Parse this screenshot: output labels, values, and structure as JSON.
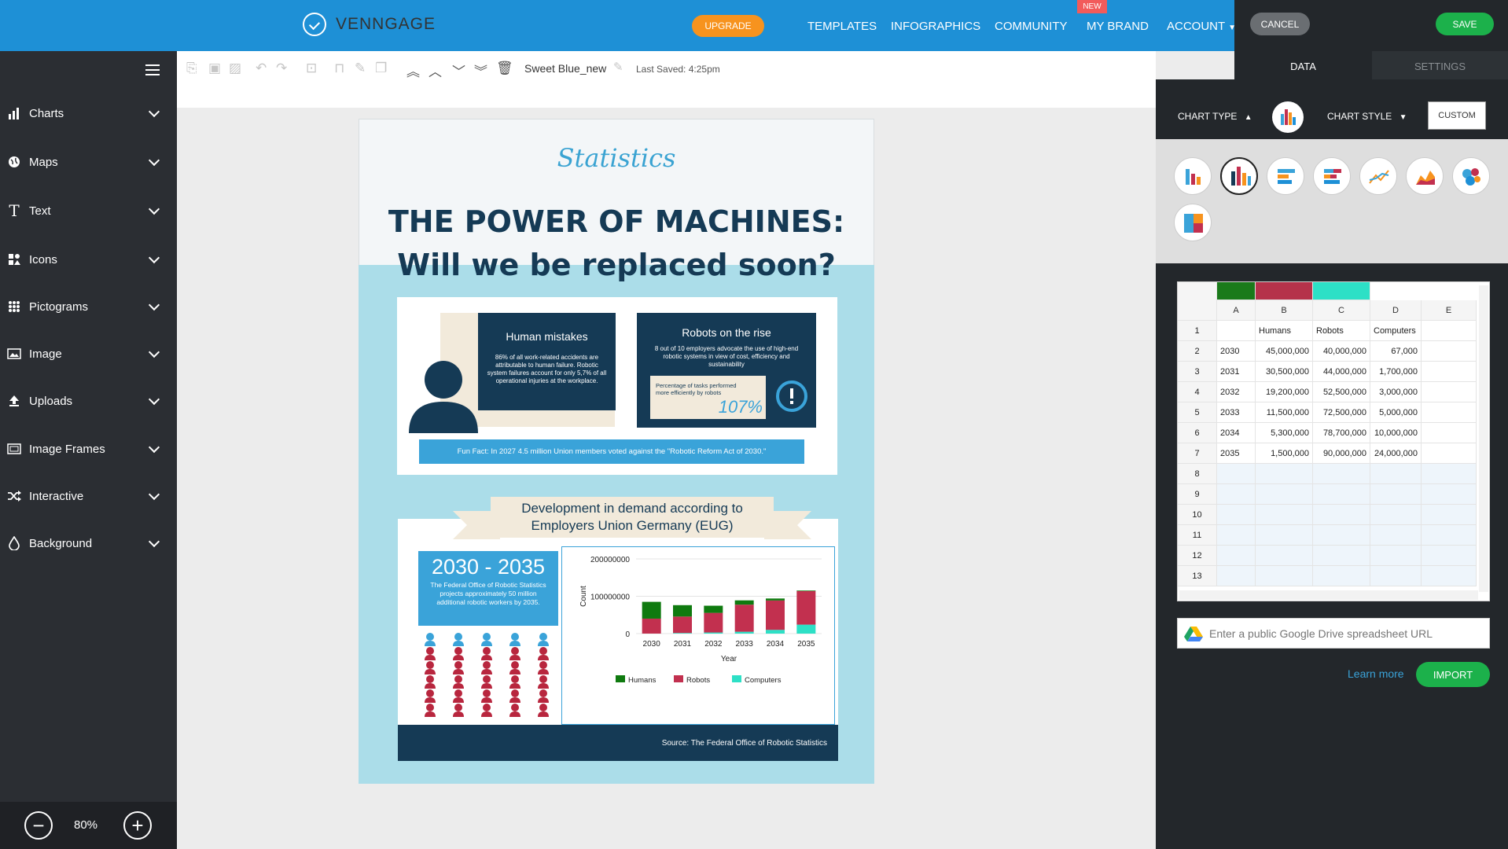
{
  "app": {
    "name": "VENNGAGE"
  },
  "nav": {
    "upgrade": "UPGRADE",
    "items": [
      "TEMPLATES",
      "INFOGRAPHICS",
      "COMMUNITY",
      "MY BRAND",
      "ACCOUNT"
    ],
    "new_badge": "NEW"
  },
  "actions": {
    "cancel": "CANCEL",
    "save": "SAVE"
  },
  "sidebar": {
    "items": [
      "Charts",
      "Maps",
      "Text",
      "Icons",
      "Pictograms",
      "Image",
      "Uploads",
      "Image Frames",
      "Interactive",
      "Background"
    ]
  },
  "zoom": {
    "level": "80%"
  },
  "toolbar": {
    "doc_name": "Sweet Blue_new",
    "last_saved": "Last Saved: 4:25pm"
  },
  "infographic": {
    "script_title": "Statistics",
    "headline_1": "THE POWER OF MACHINES:",
    "headline_2": "Will we be replaced soon?",
    "human_title": "Human mistakes",
    "human_text": "86% of all work-related accidents are attributable to human failure. Robotic system failures account for only 5,7% of all operational injuries at the workplace.",
    "robots_title": "Robots on the rise",
    "robots_text": "8 out of 10 employers advocate the use of high-end robotic systems in view of cost, efficiency and sustainability",
    "pct_label": "Percentage of tasks performed more efficiently by robots",
    "pct_value": "107%",
    "fun_fact": "Fun Fact: In 2027 4.5 million Union members voted against the \"Robotic Reform Act of 2030.\"",
    "banner_line1": "Development in demand according to",
    "banner_line2": "Employers Union Germany (EUG)",
    "range_title": "2030 - 2035",
    "range_text": "The Federal Office of Robotic Statistics projects approximately 50 million additional robotic workers by 2035.",
    "source": "Source: The Federal Office of Robotic Statistics"
  },
  "panel": {
    "tabs": [
      "DATA",
      "SETTINGS"
    ],
    "chart_type_label": "CHART TYPE",
    "chart_style_label": "CHART STYLE",
    "custom_label": "CUSTOM",
    "url_placeholder": "Enter a public Google Drive spreadsheet URL",
    "learn_more": "Learn more",
    "import": "IMPORT"
  },
  "sheet": {
    "columns": [
      "A",
      "B",
      "C",
      "D",
      "E"
    ],
    "row_numbers": [
      "1",
      "2",
      "3",
      "4",
      "5",
      "6",
      "7",
      "8",
      "9",
      "10",
      "11",
      "12",
      "13"
    ],
    "rows": [
      [
        "",
        "Humans",
        "Robots",
        "Computers",
        ""
      ],
      [
        "2030",
        "45,000,000",
        "40,000,000",
        "67,000",
        ""
      ],
      [
        "2031",
        "30,500,000",
        "44,000,000",
        "1,700,000",
        ""
      ],
      [
        "2032",
        "19,200,000",
        "52,500,000",
        "3,000,000",
        ""
      ],
      [
        "2033",
        "11,500,000",
        "72,500,000",
        "5,000,000",
        ""
      ],
      [
        "2034",
        "5,300,000",
        "78,700,000",
        "10,000,000",
        ""
      ],
      [
        "2035",
        "1,500,000",
        "90,000,000",
        "24,000,000",
        ""
      ]
    ],
    "header_colors": [
      "#1a7a1a",
      "#b5324a",
      "#2de0c6"
    ]
  },
  "chart_data": {
    "type": "bar",
    "stacked": true,
    "categories": [
      "2030",
      "2031",
      "2032",
      "2033",
      "2034",
      "2035"
    ],
    "series": [
      {
        "name": "Humans",
        "color": "#0f7a0f",
        "values": [
          45000000,
          30500000,
          19200000,
          11500000,
          5300000,
          1500000
        ]
      },
      {
        "name": "Robots",
        "color": "#c2304f",
        "values": [
          40000000,
          44000000,
          52500000,
          72500000,
          78700000,
          90000000
        ]
      },
      {
        "name": "Computers",
        "color": "#2de0c6",
        "values": [
          67000,
          1700000,
          3000000,
          5000000,
          10000000,
          24000000
        ]
      }
    ],
    "xlabel": "Year",
    "ylabel": "Count",
    "yticks": [
      "200000000",
      "100000000",
      "0"
    ],
    "ylim": [
      0,
      200000000
    ],
    "legend": "bottom"
  }
}
